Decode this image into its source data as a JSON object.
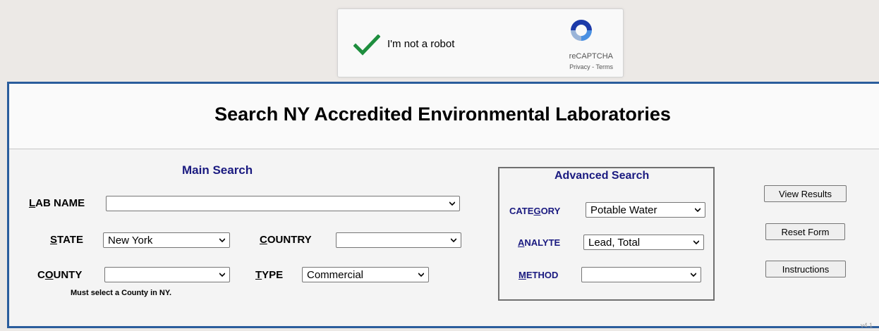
{
  "captcha": {
    "label": "I'm not a robot",
    "brand": "reCAPTCHA",
    "links": "Privacy - Terms",
    "check_color": "#1e8e3e",
    "icon": "recaptcha-logo-icon"
  },
  "page": {
    "title": "Search NY Accredited Environmental Laboratories",
    "version": "v4.1"
  },
  "main_search": {
    "title": "Main Search",
    "lab_name": {
      "label_first": "L",
      "label_rest": "AB NAME",
      "value": ""
    },
    "state": {
      "label_first": "S",
      "label_rest": "TATE",
      "value": "New York"
    },
    "country": {
      "label_first": "C",
      "label_rest": "OUNTRY",
      "value": ""
    },
    "county": {
      "label_first": "C",
      "label_u": "O",
      "label_rest": "UNTY",
      "value": ""
    },
    "type": {
      "label_first": "T",
      "label_rest": "YPE",
      "value": "Commercial"
    },
    "county_note": "Must select a County in NY."
  },
  "advanced_search": {
    "title": "Advanced Search",
    "category": {
      "label_pre": "CATE",
      "label_u": "G",
      "label_rest": "ORY",
      "value": "Potable Water"
    },
    "analyte": {
      "label_first": "A",
      "label_rest": "NALYTE",
      "value": "Lead, Total"
    },
    "method": {
      "label_first": "M",
      "label_rest": "ETHOD",
      "value": ""
    }
  },
  "buttons": {
    "view_results": "View Results",
    "reset_form": "Reset Form",
    "instructions": "Instructions"
  },
  "colors": {
    "panel_border": "#2a5d9c",
    "section_title": "#1a1a80"
  }
}
